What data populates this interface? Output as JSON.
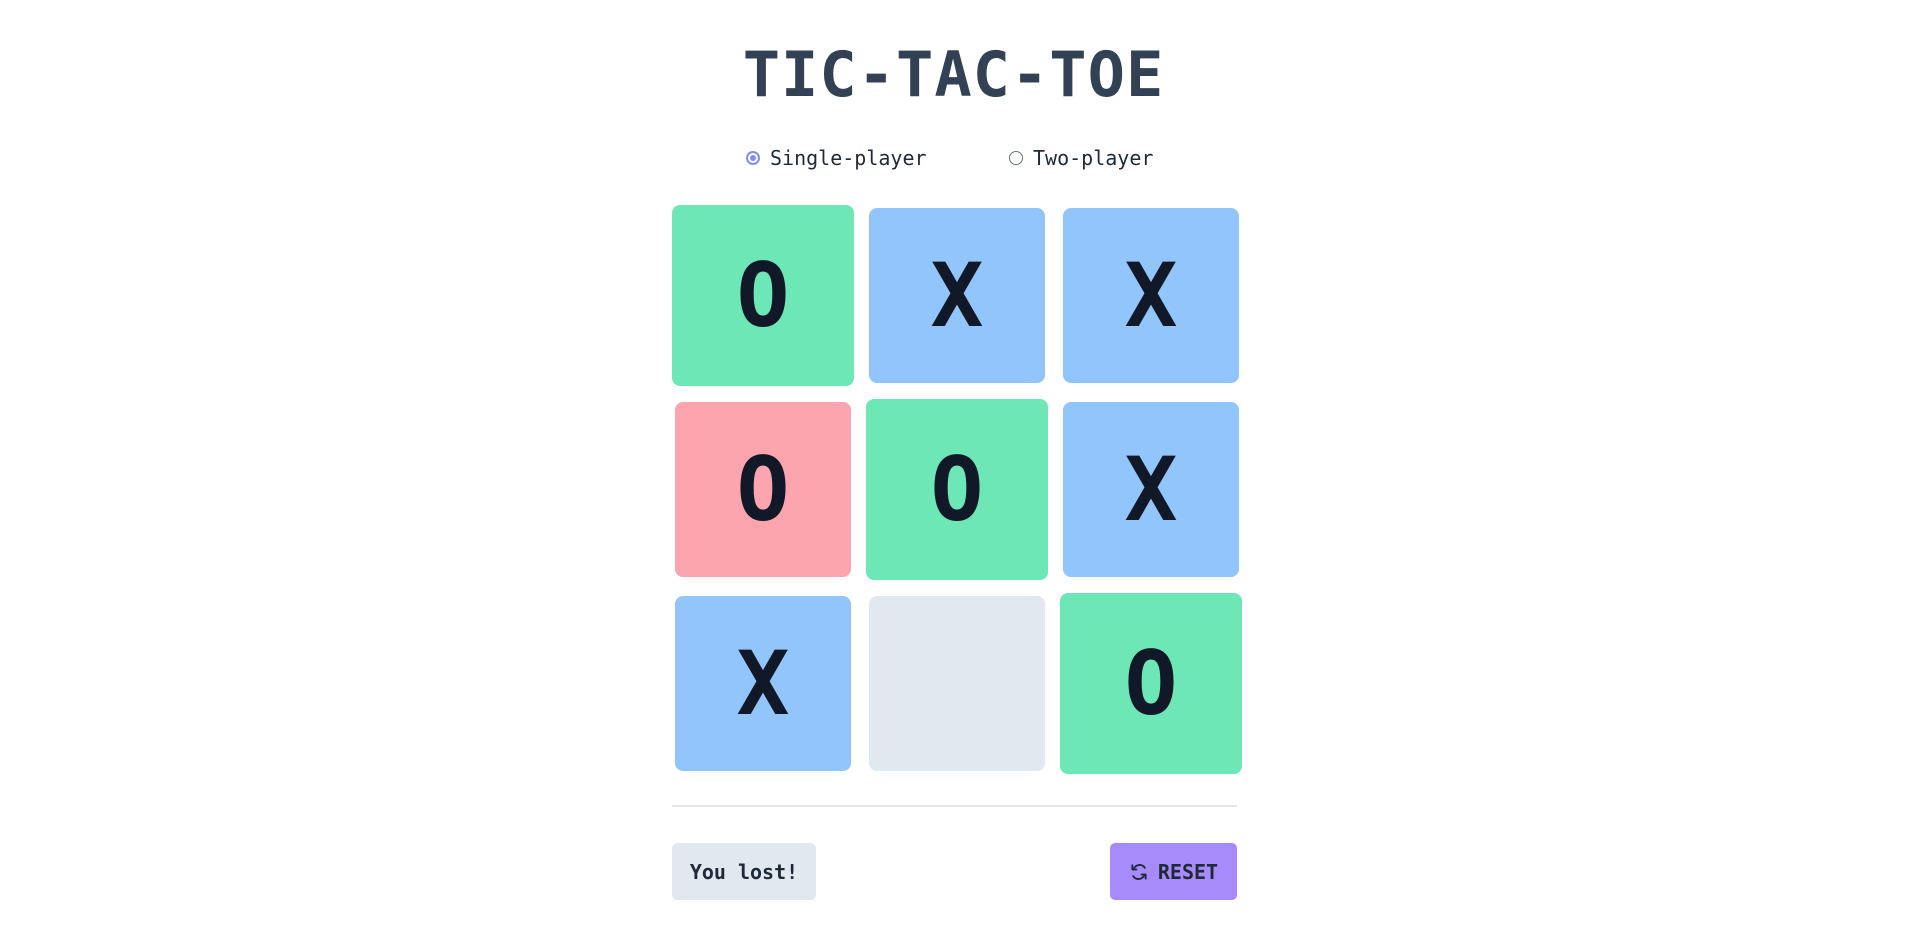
{
  "title": "TIC-TAC-TOE",
  "modes": {
    "single_label": "Single-player",
    "two_label": "Two-player",
    "selected": "single"
  },
  "colors": {
    "x_tile": "#93c5fd",
    "o_win_tile": "#6ee7b7",
    "o_tile": "#fca5af",
    "empty_tile": "#e2e8f0",
    "accent": "#818cf8",
    "reset_button": "#a78bfa"
  },
  "board": {
    "cells": [
      {
        "mark": "O",
        "state": "winning"
      },
      {
        "mark": "X",
        "state": "normal"
      },
      {
        "mark": "X",
        "state": "normal"
      },
      {
        "mark": "O",
        "state": "normal"
      },
      {
        "mark": "O",
        "state": "winning"
      },
      {
        "mark": "X",
        "state": "normal"
      },
      {
        "mark": "X",
        "state": "normal"
      },
      {
        "mark": "",
        "state": "empty"
      },
      {
        "mark": "O",
        "state": "winning"
      }
    ]
  },
  "status": {
    "text": "You lost!"
  },
  "reset": {
    "label": "RESET",
    "icon": "refresh-icon"
  }
}
